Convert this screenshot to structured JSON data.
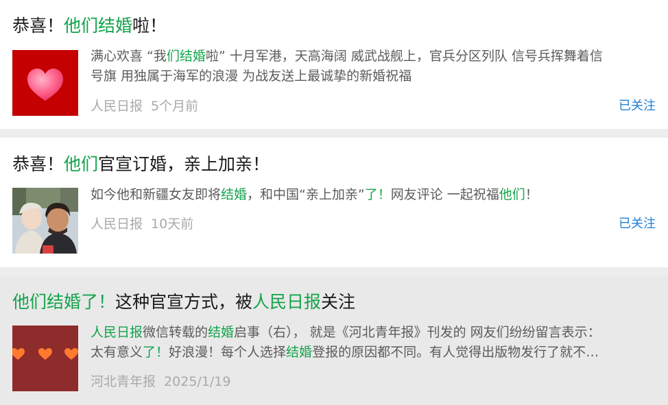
{
  "colors": {
    "highlight": "#12a34a",
    "follow": "#1e7fd8",
    "meta": "#a9a9a9"
  },
  "items": [
    {
      "title_pre": "恭喜！",
      "title_hl": "他们结婚",
      "title_post": "啦！",
      "thumb_icon": "heart-icon",
      "desc_l1_a": "满心欢喜 “我",
      "desc_l1_hl": "们结婚",
      "desc_l1_b": "啦” 十月军港，天高海阔 威武战舰上，官兵分区列队 信号兵挥舞着信",
      "desc_l2": "号旗 用独属于海军的浪漫 为战友送上最诚挚的新婚祝福",
      "source": "人民日报",
      "time": "5个月前",
      "follow": "已关注"
    },
    {
      "title_pre": "恭喜！",
      "title_hl": "他们",
      "title_post": "官宣订婚，亲上加亲！",
      "thumb_icon": "couple-photo",
      "desc_a": "如今他和新疆女友即将",
      "desc_hl1": "结婚",
      "desc_b": "，和中国“亲上加亲”",
      "desc_hl2": "了！",
      "desc_c": "网友评论 一起祝福",
      "desc_hl3": "他们",
      "desc_d": "！",
      "source": "人民日报",
      "time": "10天前",
      "follow": "已关注"
    },
    {
      "title_hl": "他们结婚了！",
      "title_mid": "这种官宣方式，被",
      "title_hl2": "人民日报",
      "title_post": "关注",
      "thumb_icon": "hearts-icon",
      "desc_l1_hl1": "人民日报",
      "desc_l1_a": "微信转载的",
      "desc_l1_hl2": "结婚",
      "desc_l1_b": "启事（右），  就是《河北青年报》刊发的 网友们纷纷留言表示：",
      "desc_l2_a": "太有意义",
      "desc_l2_hl1": "了！",
      "desc_l2_b": "好浪漫！每个人选择",
      "desc_l2_hl2": "结婚",
      "desc_l2_c": "登报的原因都不同。有人觉得出版物发行了就不…",
      "source": "河北青年报",
      "time": "2025/1/19"
    }
  ]
}
